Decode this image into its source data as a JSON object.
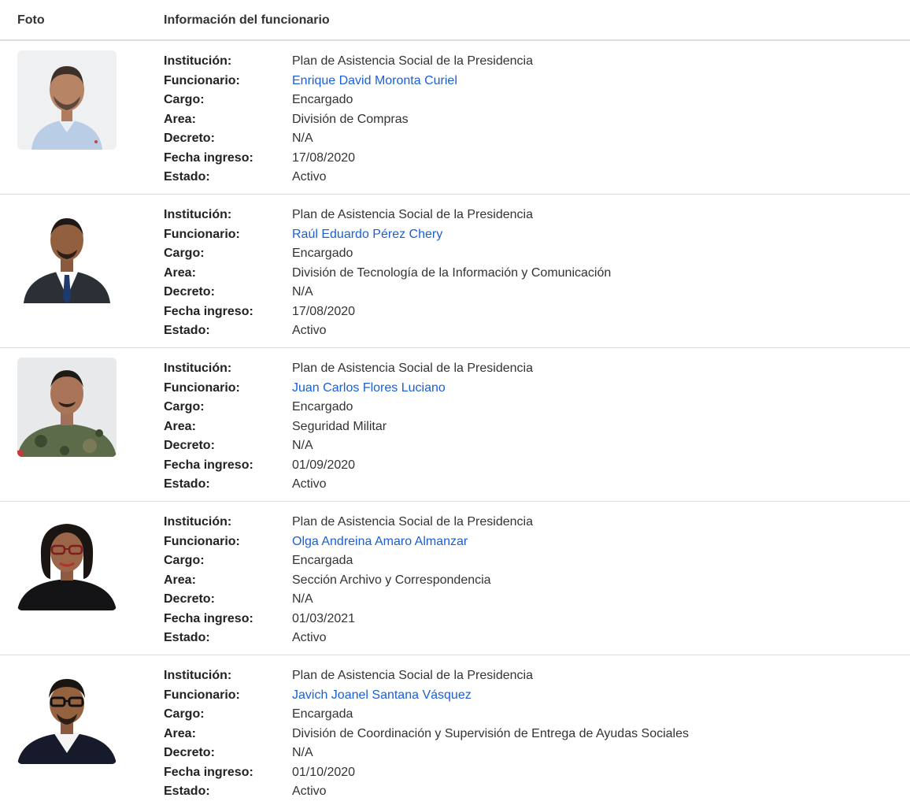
{
  "header": {
    "foto": "Foto",
    "info": "Información del funcionario"
  },
  "labels": {
    "institucion": "Institución:",
    "funcionario": "Funcionario:",
    "cargo": "Cargo:",
    "area": "Area:",
    "decreto": "Decreto:",
    "fecha": "Fecha ingreso:",
    "estado": "Estado:"
  },
  "colors": {
    "link": "#1a5fd6",
    "divider": "#dddddd"
  },
  "rows": [
    {
      "institucion": "Plan de Asistencia Social de la Presidencia",
      "funcionario": "Enrique David Moronta Curiel",
      "cargo": "Encargado",
      "area": "División de Compras",
      "decreto": "N/A",
      "fecha": "17/08/2020",
      "estado": "Activo"
    },
    {
      "institucion": "Plan de Asistencia Social de la Presidencia",
      "funcionario": "Raúl Eduardo Pérez Chery",
      "cargo": "Encargado",
      "area": "División de Tecnología de la Información y Comunicación",
      "decreto": "N/A",
      "fecha": "17/08/2020",
      "estado": "Activo"
    },
    {
      "institucion": "Plan de Asistencia Social de la Presidencia",
      "funcionario": "Juan Carlos Flores Luciano",
      "cargo": "Encargado",
      "area": "Seguridad Militar",
      "decreto": "N/A",
      "fecha": "01/09/2020",
      "estado": "Activo"
    },
    {
      "institucion": "Plan de Asistencia Social de la Presidencia",
      "funcionario": "Olga Andreina Amaro Almanzar",
      "cargo": "Encargada",
      "area": "Sección Archivo y Correspondencia",
      "decreto": "N/A",
      "fecha": "01/03/2021",
      "estado": "Activo"
    },
    {
      "institucion": "Plan de Asistencia Social de la Presidencia",
      "funcionario": "Javich Joanel Santana Vásquez",
      "cargo": "Encargada",
      "area": "División de Coordinación y Supervisión de Entrega de Ayudas Sociales",
      "decreto": "N/A",
      "fecha": "01/10/2020",
      "estado": "Activo"
    }
  ]
}
